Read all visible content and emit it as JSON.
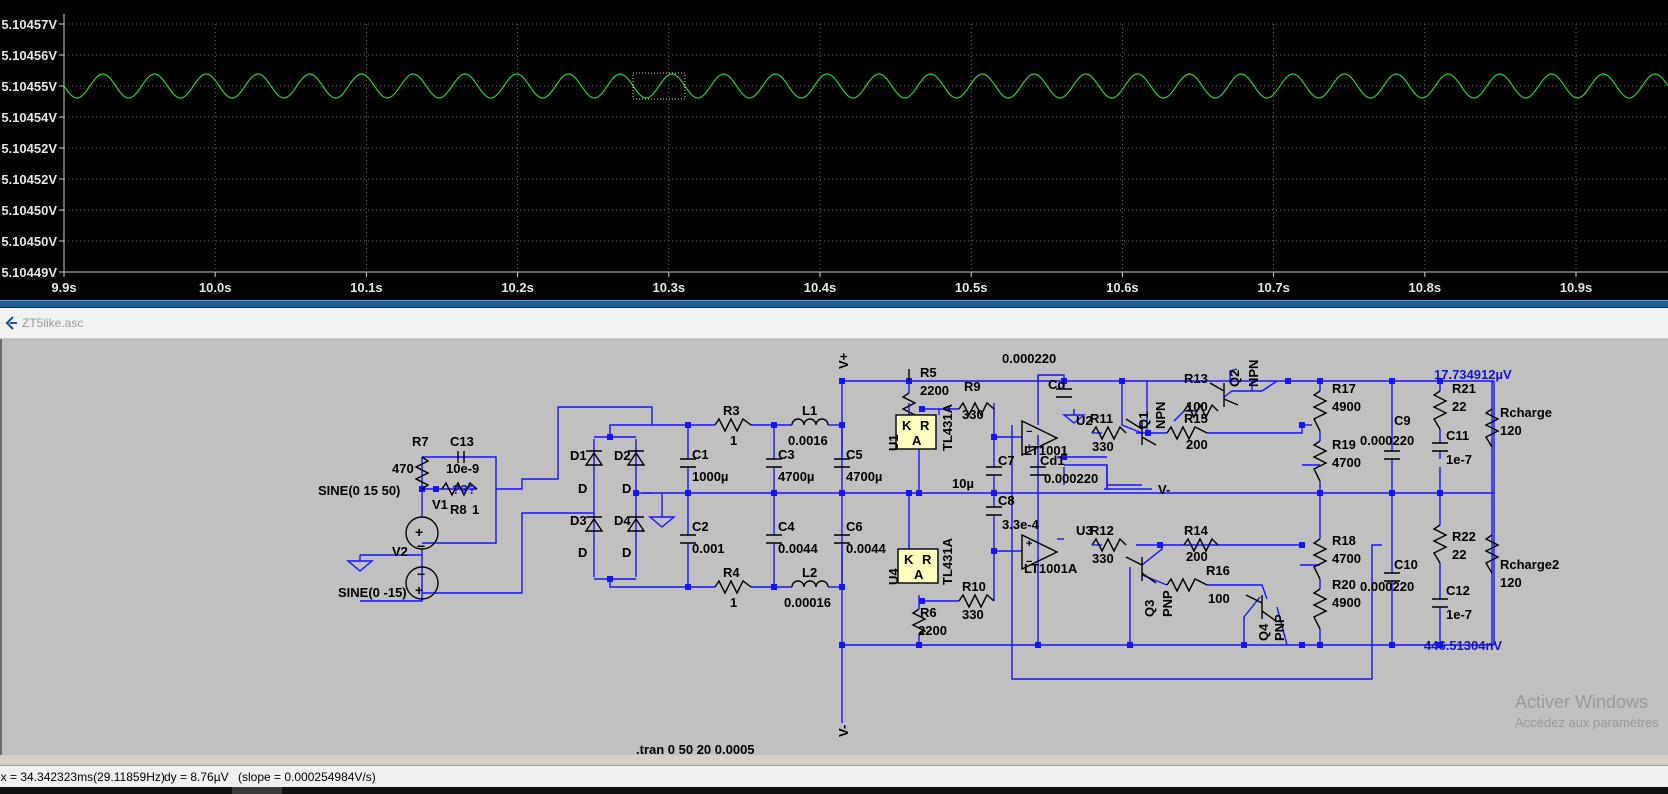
{
  "plot": {
    "chart_data": {
      "type": "line",
      "xlim": [
        "9.9s",
        "10.96s"
      ],
      "ylim": [
        "5.10449V",
        "5.10457V"
      ],
      "y_tick_labels": [
        "5.10457V",
        "5.10456V",
        "5.10455V",
        "5.10454V",
        "5.10452V",
        "5.10452V",
        "5.10450V",
        "5.10450V",
        "5.10449V"
      ],
      "x_tick_labels": [
        "9.9s",
        "10.0s",
        "10.1s",
        "10.2s",
        "10.3s",
        "10.4s",
        "10.5s",
        "10.6s",
        "10.7s",
        "10.8s",
        "10.9s"
      ],
      "series": [
        {
          "color": "#2bd12b",
          "shape": "sine",
          "center_V": 5.10455,
          "peak_to_peak_uV": 8.76,
          "frequency_hz": 29.11859,
          "cycles_in_view": 31
        }
      ],
      "grid": true,
      "grid_style": "dotted",
      "cursor_box": {
        "x_start": "10.28s",
        "x_end": "10.31s"
      }
    },
    "background": "#000000",
    "grid_color": "#6a6a6a",
    "label_color": "#e6e6e6"
  },
  "schematic": {
    "title": "ZT5like.asc",
    "components": {
      "R7": {
        "name": "R7",
        "value": "470"
      },
      "C13": {
        "name": "C13",
        "value": "10e-9"
      },
      "R8": {
        "name": "R8",
        "value": "1",
        "extra": "???"
      },
      "V1": {
        "name": "V1",
        "source": "SINE(0 15 50)"
      },
      "V2": {
        "name": "V2",
        "source": "SINE(0 -15)"
      },
      "D1": {
        "name": "D1",
        "type": "D"
      },
      "D2": {
        "name": "D2",
        "type": "D"
      },
      "D3": {
        "name": "D3",
        "type": "D"
      },
      "D4": {
        "name": "D4",
        "type": "D"
      },
      "R3": {
        "name": "R3",
        "value": "1"
      },
      "R4": {
        "name": "R4",
        "value": "1"
      },
      "L1": {
        "name": "L1",
        "value": "0.0016"
      },
      "L2": {
        "name": "L2",
        "value": "0.00016"
      },
      "C1": {
        "name": "C1",
        "value": "1000µ"
      },
      "C2": {
        "name": "C2",
        "value": "0.001"
      },
      "C3": {
        "name": "C3",
        "value": "4700µ"
      },
      "C4": {
        "name": "C4",
        "value": "0.0044"
      },
      "C5": {
        "name": "C5",
        "value": "4700µ"
      },
      "C6": {
        "name": "C6",
        "value": "0.0044"
      },
      "R5": {
        "name": "R5",
        "value": "2200"
      },
      "R6": {
        "name": "R6",
        "value": "2200"
      },
      "R9": {
        "name": "R9",
        "value": "330"
      },
      "R10": {
        "name": "R10",
        "value": "330"
      },
      "U1": {
        "name": "U1",
        "part": "TL431A",
        "pin_k": "K",
        "pin_a": "A",
        "pin_r": "R"
      },
      "U4": {
        "name": "U4",
        "part": "TL431A",
        "pin_k": "K",
        "pin_a": "A",
        "pin_r": "R"
      },
      "C7": {
        "name": "C7",
        "value": "10µ"
      },
      "C8": {
        "name": "C8",
        "value": "3.3e-4"
      },
      "Cd": {
        "name": "Cd",
        "value": "0.000220"
      },
      "Cd1": {
        "name": "Cd1",
        "value": "0.000220"
      },
      "U2": {
        "name": "U2",
        "part": "LT1001"
      },
      "U3": {
        "name": "U3",
        "part": "LT1001A"
      },
      "R11": {
        "name": "R11",
        "value": "330"
      },
      "R12": {
        "name": "R12",
        "value": "330"
      },
      "R13": {
        "name": "R13",
        "value": "100"
      },
      "R14": {
        "name": "R14",
        "value": "200"
      },
      "R15": {
        "name": "R15",
        "value": "200"
      },
      "R16": {
        "name": "R16",
        "value": "100"
      },
      "Q1": {
        "name": "Q1",
        "type": "NPN"
      },
      "Q2": {
        "name": "Q2",
        "type": "NPN"
      },
      "Q3": {
        "name": "Q3",
        "type": "PNP"
      },
      "Q4": {
        "name": "Q4",
        "type": "PNP"
      },
      "R17": {
        "name": "R17",
        "value": "4900"
      },
      "R18": {
        "name": "R18",
        "value": "4700"
      },
      "R19": {
        "name": "R19",
        "value": "4700"
      },
      "R20": {
        "name": "R20",
        "value": "4900"
      },
      "C9": {
        "name": "C9",
        "value": "0.000220"
      },
      "C10": {
        "name": "C10",
        "value": "0.000220"
      },
      "R21": {
        "name": "R21",
        "value": "22"
      },
      "R22": {
        "name": "R22",
        "value": "22"
      },
      "C11": {
        "name": "C11",
        "value": "1e-7"
      },
      "C12": {
        "name": "C12",
        "value": "1e-7"
      },
      "Rcharge": {
        "name": "Rcharge",
        "value": "120"
      },
      "Rcharge2": {
        "name": "Rcharge2",
        "value": "120"
      }
    },
    "net_labels": {
      "vplus": "V+",
      "vminus": "V-",
      "vminus_mid": "V-"
    },
    "probe_top": "17.734912µV",
    "probe_bottom": "446.51304nV",
    "directive": ".tran 0 50 20 0.0005"
  },
  "status": {
    "dx": "dx = 34.342323ms(29.11859Hz)",
    "dy": "dy = 8.76µV",
    "slope": "(slope = 0.000254984V/s)"
  },
  "watermark": {
    "line1": "Activer Windows",
    "line2": "Accédez aux paramètres"
  },
  "colors": {
    "wire": "#1414ff",
    "trace": "#2bd12b",
    "schematic_bg": "#c0c0c0",
    "label_blue": "#1414c8",
    "ic_fill": "#ffffc0"
  },
  "icons": {
    "schematic_tab": "ltspice-schematic-icon",
    "ground": "ground-icon",
    "voltage_source": "voltage-source-icon"
  }
}
